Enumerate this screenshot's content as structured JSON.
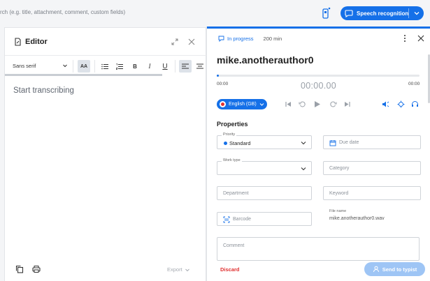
{
  "topbar": {
    "search_placeholder": "rch (e.g. title, attachment, comment, custom fields)",
    "speech_button_label": "Speech recognition"
  },
  "editor": {
    "title": "Editor",
    "font": "Sans serif",
    "font_size_label": "AA",
    "bold_label": "B",
    "italic_label": "I",
    "underline_label": "U",
    "body_text": "Start transcribing",
    "export_label": "Export"
  },
  "details": {
    "status": "In progress",
    "duration": "200 min",
    "author": "mike.anotherauthor0",
    "time_start": "00:00",
    "time_current": "00:00.00",
    "time_end": "00:00",
    "progress_fraction": 0.01,
    "language": "English (GB)",
    "properties_title": "Properties",
    "priority_label": "Priority",
    "priority_value": "Standard",
    "due_date_placeholder": "Due date",
    "work_type_label": "Work type",
    "category_placeholder": "Category",
    "department_placeholder": "Department",
    "keyword_placeholder": "Keyword",
    "barcode_placeholder": "Barcode",
    "file_name_label": "File name",
    "file_name_value": "mike.anotherauthor0.wav",
    "comment_placeholder": "Comment",
    "discard_label": "Discard",
    "send_label": "Send to typist"
  },
  "colors": {
    "accent": "#1570e8",
    "danger": "#e03030",
    "send_disabled": "#9ec5f5"
  }
}
